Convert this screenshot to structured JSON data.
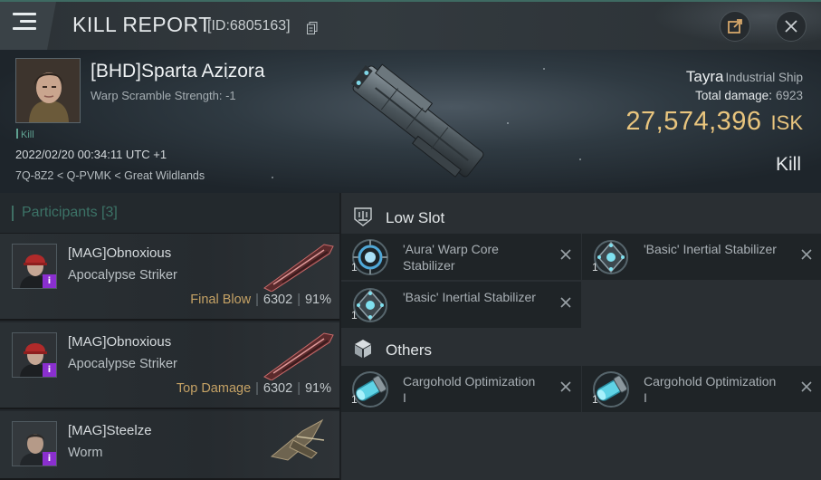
{
  "header": {
    "title": "KILL REPORT",
    "report_id": "[ID:6805163]"
  },
  "victim": {
    "name": "[BHD]Sparta Azizora",
    "warp_scramble": "Warp Scramble Strength: -1",
    "kill_tag": "Kill",
    "datetime": "2022/02/20 00:34:11 UTC +1",
    "location": "7Q-8Z2 < Q-PVMK < Great Wildlands",
    "ship_name": "Tayra",
    "ship_class": "Industrial Ship",
    "total_damage_label": "Total damage:",
    "total_damage": "6923",
    "isk_value": "27,574,396",
    "isk_unit": "ISK",
    "result": "Kill"
  },
  "participants": {
    "heading": "Participants [3]",
    "rows": [
      {
        "name": "[MAG]Obnoxious",
        "ship": "Apocalypse Striker",
        "tag": "Final Blow",
        "damage": "6302",
        "percent": "91%",
        "badge": "i"
      },
      {
        "name": "[MAG]Obnoxious",
        "ship": "Apocalypse Striker",
        "tag": "Top Damage",
        "damage": "6302",
        "percent": "91%",
        "badge": "i"
      },
      {
        "name": "[MAG]Steelze",
        "ship": "Worm",
        "badge": "i"
      }
    ]
  },
  "fitting": {
    "low_slot": {
      "label": "Low Slot",
      "modules": [
        {
          "name": "'Aura' Warp Core Stabilizer",
          "qty": "1",
          "icon": "warp-core-stabilizer-icon"
        },
        {
          "name": "'Basic' Inertial Stabilizer",
          "qty": "1",
          "icon": "inertial-stabilizer-icon"
        },
        {
          "name": "'Basic' Inertial Stabilizer",
          "qty": "1",
          "icon": "inertial-stabilizer-icon"
        }
      ]
    },
    "others": {
      "label": "Others",
      "modules": [
        {
          "name": "Cargohold Optimization I",
          "qty": "1",
          "icon": "cargohold-optimization-icon"
        },
        {
          "name": "Cargohold Optimization I",
          "qty": "1",
          "icon": "cargohold-optimization-icon"
        }
      ]
    }
  },
  "colors": {
    "accent": "#3f6f64",
    "isk": "#e9c57e",
    "tag_gold": "#c5a265",
    "badge_purple": "#8a2fcf"
  }
}
